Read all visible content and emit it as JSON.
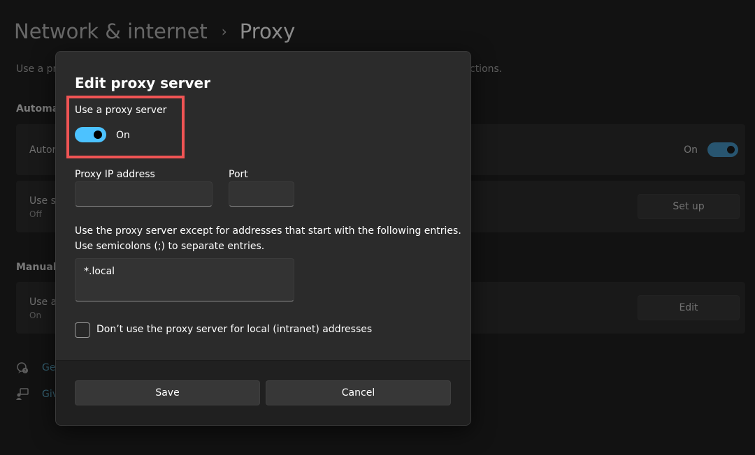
{
  "background": {
    "breadcrumb": {
      "parent": "Network & internet",
      "separator": "›",
      "current": "Proxy"
    },
    "description_start": "Use a pr",
    "description_end": "ctions.",
    "automatic_heading": "Automa",
    "auto_detect": {
      "title": "Autor",
      "toggle_label": "On"
    },
    "setup_script": {
      "title": "Use s",
      "status": "Off",
      "button": "Set up"
    },
    "manual_heading": "Manual",
    "manual_proxy": {
      "title": "Use a",
      "status": "On",
      "button": "Edit"
    },
    "links": [
      {
        "icon": "help-chat-icon",
        "label": "Ge"
      },
      {
        "icon": "feedback-icon",
        "label": "Giv"
      }
    ]
  },
  "dialog": {
    "title": "Edit proxy server",
    "use_proxy_label": "Use a proxy server",
    "toggle": {
      "state": "On",
      "on": true
    },
    "ip_label": "Proxy IP address",
    "ip_value": "",
    "port_label": "Port",
    "port_value": "",
    "exceptions_description_line1": "Use the proxy server except for addresses that start with the following entries.",
    "exceptions_description_line2": "Use semicolons (;) to separate entries.",
    "exceptions_value": "*.local",
    "local_checkbox_label": "Don’t use the proxy server for local (intranet) addresses",
    "local_checkbox_checked": false,
    "save_label": "Save",
    "cancel_label": "Cancel"
  },
  "colors": {
    "accent": "#4cc2ff",
    "highlight": "#f05454",
    "dialog_bg": "#2b2b2b"
  }
}
